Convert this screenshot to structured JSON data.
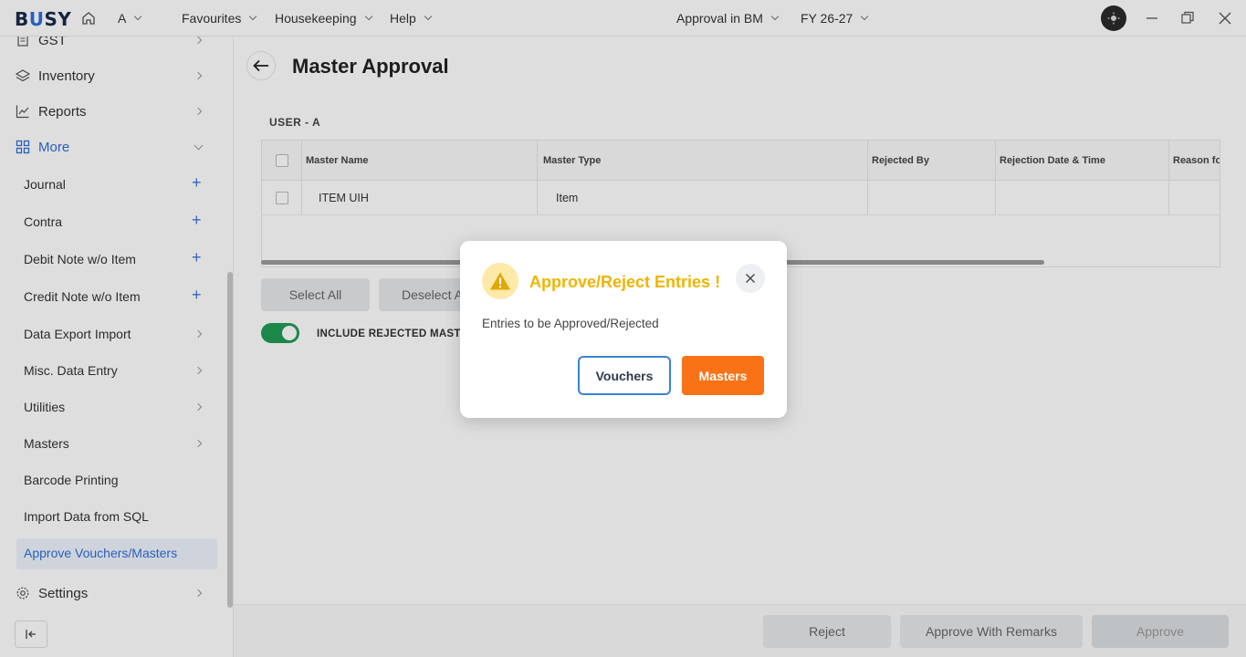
{
  "titlebar": {
    "logo": "BUSY",
    "company": "A",
    "menus": [
      "Favourites",
      "Housekeeping",
      "Help"
    ],
    "approval_label": "Approval in BM",
    "fy_label": "FY 26-27"
  },
  "sidebar": {
    "top_items": [
      {
        "label": "GST",
        "icon": "document-icon"
      },
      {
        "label": "Inventory",
        "icon": "layers-icon"
      },
      {
        "label": "Reports",
        "icon": "chart-icon"
      },
      {
        "label": "More",
        "icon": "grid-icon"
      }
    ],
    "sub_items": [
      {
        "label": "Journal",
        "action": "+"
      },
      {
        "label": "Contra",
        "action": "+"
      },
      {
        "label": "Debit Note w/o Item",
        "action": "+"
      },
      {
        "label": "Credit Note w/o Item",
        "action": "+"
      },
      {
        "label": "Data Export Import",
        "action": ">"
      },
      {
        "label": "Misc. Data Entry",
        "action": ">"
      },
      {
        "label": "Utilities",
        "action": ">"
      },
      {
        "label": "Masters",
        "action": ">"
      },
      {
        "label": "Barcode Printing",
        "action": ""
      },
      {
        "label": "Import Data from SQL",
        "action": ""
      },
      {
        "label": "Approve Vouchers/Masters",
        "action": ""
      }
    ],
    "settings": "Settings"
  },
  "main": {
    "title": "Master Approval",
    "user_label": "USER - A",
    "columns": [
      "Master Name",
      "Master Type",
      "Rejected By",
      "Rejection Date & Time",
      "Reason fo"
    ],
    "rows": [
      {
        "master_name": "ITEM UIH",
        "master_type": "Item",
        "rejected_by": "",
        "rejection_date": "",
        "reason": ""
      }
    ],
    "select_all": "Select All",
    "deselect_all": "Deselect A",
    "toggle_label": "INCLUDE REJECTED MASTE",
    "footer_buttons": {
      "reject": "Reject",
      "approve_remarks": "Approve With Remarks",
      "approve": "Approve"
    }
  },
  "modal": {
    "title": "Approve/Reject Entries !",
    "message": "Entries to be Approved/Rejected",
    "vouchers": "Vouchers",
    "masters": "Masters"
  },
  "colors": {
    "accent": "#f97316",
    "warning": "#f0b400",
    "link": "#2d6fd8",
    "toggle": "#1f9d55"
  }
}
